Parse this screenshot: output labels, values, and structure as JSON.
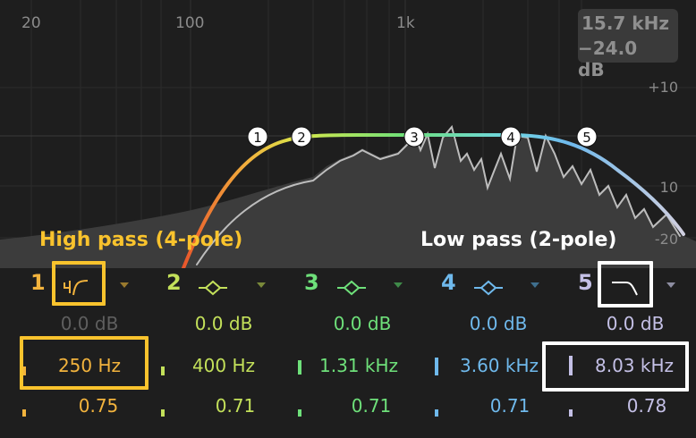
{
  "colors": {
    "background": "#1e1e1e",
    "grid": "#2e2e2e",
    "highlight_yellow": "#f9c32d",
    "highlight_white": "#ffffff",
    "band1": "#f2b33d",
    "band2": "#c3e05a",
    "band3": "#6ee07a",
    "band4": "#6fb9ec",
    "band5": "#c4c0e6"
  },
  "graph": {
    "freq_labels": [
      "20",
      "100",
      "1k"
    ],
    "db_labels": [
      "+10",
      "10",
      "-20"
    ],
    "readout": {
      "freq": "15.7 kHz",
      "gain": "−24.0 dB"
    },
    "nodes": [
      "1",
      "2",
      "3",
      "4",
      "5"
    ]
  },
  "annotations": {
    "high_pass": "High pass (4-pole)",
    "low_pass": "Low pass (2-pole)"
  },
  "bands": [
    {
      "number": "1",
      "icon": "high-pass-4-pole-icon",
      "gain": "0.0 dB",
      "freq": "250 Hz",
      "q": "0.75"
    },
    {
      "number": "2",
      "icon": "bell-icon",
      "gain": "0.0 dB",
      "freq": "400 Hz",
      "q": "0.71"
    },
    {
      "number": "3",
      "icon": "bell-icon",
      "gain": "0.0 dB",
      "freq": "1.31 kHz",
      "q": "0.71"
    },
    {
      "number": "4",
      "icon": "bell-icon",
      "gain": "0.0 dB",
      "freq": "3.60 kHz",
      "q": "0.71"
    },
    {
      "number": "5",
      "icon": "low-pass-2-pole-icon",
      "gain": "0.0 dB",
      "freq": "8.03 kHz",
      "q": "0.78"
    }
  ]
}
